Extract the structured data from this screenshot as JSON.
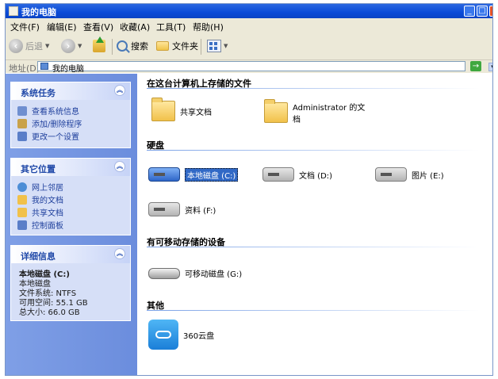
{
  "window": {
    "title": "我的电脑"
  },
  "title_controls": {
    "minimize": "_",
    "maximize": "□",
    "close": "×"
  },
  "menu": [
    "文件(F)",
    "编辑(E)",
    "查看(V)",
    "收藏(A)",
    "工具(T)",
    "帮助(H)"
  ],
  "toolbar": {
    "back": "后退",
    "search": "搜索",
    "folders": "文件夹"
  },
  "address": {
    "label": "地址(D)",
    "value": "我的电脑",
    "go": "→"
  },
  "sidebar": {
    "system_tasks": {
      "title": "系统任务",
      "items": [
        "查看系统信息",
        "添加/删除程序",
        "更改一个设置"
      ]
    },
    "other_places": {
      "title": "其它位置",
      "items": [
        "网上邻居",
        "我的文档",
        "共享文档",
        "控制面板"
      ]
    },
    "details": {
      "title": "详细信息",
      "name": "本地磁盘 (C:)",
      "type": "本地磁盘",
      "filesystem": "文件系统: NTFS",
      "free": "可用空间: 55.1 GB",
      "total": "总大小: 66.0 GB"
    }
  },
  "content": {
    "groups": [
      {
        "title": "在这台计算机上存储的文件",
        "items": [
          "共享文档",
          "Administrator 的文档"
        ]
      },
      {
        "title": "硬盘",
        "items": [
          "本地磁盘 (C:)",
          "文档 (D:)",
          "图片 (E:)",
          "资料 (F:)"
        ]
      },
      {
        "title": "有可移动存储的设备",
        "items": [
          "可移动磁盘 (G:)"
        ]
      },
      {
        "title": "其他",
        "items": [
          "360云盘"
        ]
      }
    ]
  },
  "colors": {
    "titlebar": "#0a4bd8",
    "sidebar": "#7f9fe6",
    "panel": "#d6dff7",
    "selection": "#3169c6"
  }
}
